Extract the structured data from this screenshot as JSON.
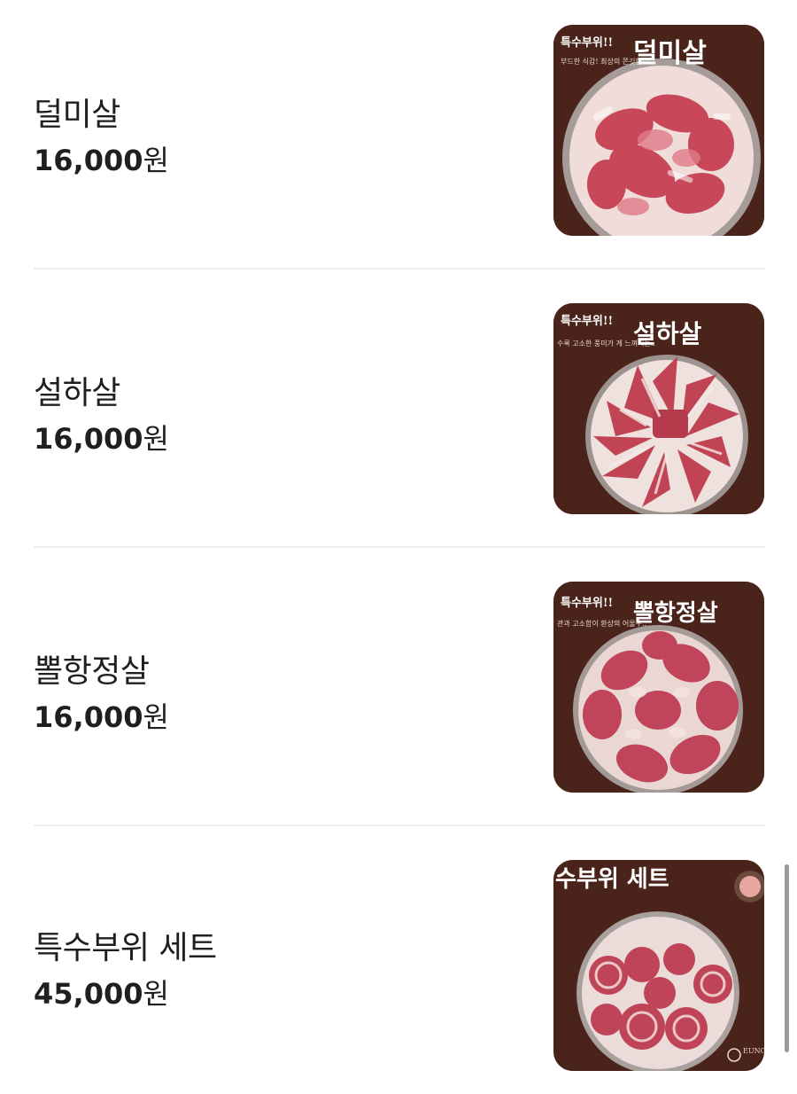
{
  "menu": {
    "items": [
      {
        "name": "덜미살",
        "price_number": "16,000",
        "price_unit": "원",
        "image": {
          "badge": "특수부위!!",
          "title": "덜미살",
          "caption": "부드한 식감! 최상의 쫀깃함!"
        }
      },
      {
        "name": "설하살",
        "price_number": "16,000",
        "price_unit": "원",
        "image": {
          "badge": "특수부위!!",
          "title": "설하살",
          "caption": "수록 고소한 풍미가 게 느껴지는.."
        }
      },
      {
        "name": "뽈항정살",
        "price_number": "16,000",
        "price_unit": "원",
        "image": {
          "badge": "특수부위!!",
          "title": "뽈항정살",
          "caption": "관과 고소함이 환상의 어울우.."
        }
      },
      {
        "name": "특수부위 세트",
        "price_number": "45,000",
        "price_unit": "원",
        "image": {
          "badge": "",
          "title": "수부위 세트",
          "caption": "",
          "logo_text": "EUNG HO"
        }
      }
    ]
  },
  "colors": {
    "thumb_background": "#4a231a",
    "meat": "#c8485a",
    "fat": "#f3e2df",
    "divider": "#f0f0f0",
    "text": "#1f1f1f"
  }
}
